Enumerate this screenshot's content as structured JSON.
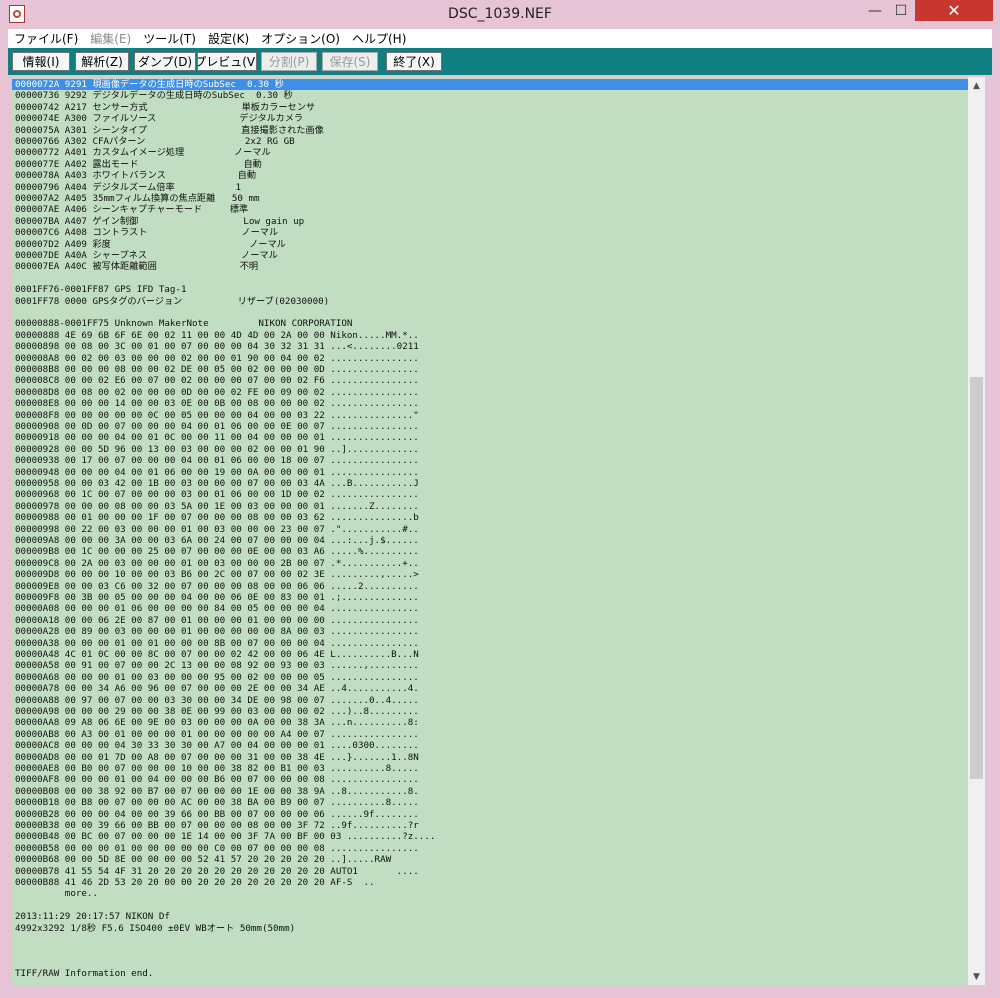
{
  "window": {
    "title": "DSC_1039.NEF",
    "minimize": "—",
    "maximize": "☐",
    "close": "✕"
  },
  "menu": [
    "ファイル(F)",
    "編集(E)",
    "ツール(T)",
    "設定(K)",
    "オプション(O)",
    "ヘルプ(H)"
  ],
  "menu_disabled": [
    false,
    true,
    false,
    false,
    false,
    false
  ],
  "toolbar": {
    "buttons": [
      "情報(I)",
      "解析(Z)",
      "ダンプ(D)",
      "プレビュ(V)",
      "分割(P)",
      "保存(S)",
      "終了(X)"
    ],
    "disabled": [
      false,
      false,
      false,
      false,
      true,
      true,
      false
    ]
  },
  "scrollbar": {
    "position": 0.6,
    "visible_fraction": 0.46
  },
  "lines": [
    "0000072A 9291 現画像データの生成日時のSubSec  0.30 秒",
    "00000736 9292 デジタルデータの生成日時のSubSec  0.30 秒",
    "00000742 A217 センサー方式                 単板カラーセンサ",
    "0000074E A300 ファイルソース               デジタルカメラ",
    "0000075A A301 シーンタイプ                 直接撮影された画像",
    "00000766 A302 CFAパターン                  2x2 RG GB",
    "00000772 A401 カスタムイメージ処理         ノーマル",
    "0000077E A402 露出モード                   自動",
    "0000078A A403 ホワイトバランス             自動",
    "00000796 A404 デジタルズーム倍率           1",
    "000007A2 A405 35mmフィルム換算の焦点距離   50 mm",
    "000007AE A406 シーンキャプチャーモード     標準",
    "000007BA A407 ゲイン制御                   Low gain up",
    "000007C6 A408 コントラスト                 ノーマル",
    "000007D2 A409 彩度                         ノーマル",
    "000007DE A40A シャープネス                 ノーマル",
    "000007EA A40C 被写体距離範囲               不明",
    "",
    "0001FF76-0001FF87 GPS IFD Tag-1",
    "0001FF78 0000 GPSタグのバージョン          リザーブ(02030000)",
    "",
    "00000888-0001FF75 Unknown MakerNote         NIKON CORPORATION",
    "00000888 4E 69 6B 6F 6E 00 02 11 00 00 4D 4D 00 2A 00 00 Nikon.....MM.*..",
    "00000898 00 08 00 3C 00 01 00 07 00 00 00 04 30 32 31 31 ...<........0211",
    "000008A8 00 02 00 03 00 00 00 02 00 00 01 90 00 04 00 02 ................",
    "000008B8 00 00 00 08 00 00 02 DE 00 05 00 02 00 00 00 0D ................",
    "000008C8 00 00 02 E6 00 07 00 02 00 00 00 07 00 00 02 F6 ................",
    "000008D8 00 08 00 02 00 00 00 0D 00 00 02 FE 00 09 00 02 ................",
    "000008E8 00 00 00 14 00 00 03 0E 00 0B 00 08 00 00 00 02 ................",
    "000008F8 00 00 00 00 00 0C 00 05 00 00 00 04 00 00 03 22 ...............\"",
    "00000908 00 0D 00 07 00 00 00 04 00 01 06 00 00 0E 00 07 ................",
    "00000918 00 00 00 04 00 01 0C 00 00 11 00 04 00 00 00 01 ................",
    "00000928 00 00 5D 96 00 13 00 03 00 00 00 02 00 00 01 90 ..].............",
    "00000938 00 17 00 07 00 00 00 04 00 01 06 00 00 18 00 07 ................",
    "00000948 00 00 00 04 00 01 06 00 00 19 00 0A 00 00 00 01 ................",
    "00000958 00 00 03 42 00 1B 00 03 00 00 00 07 00 00 03 4A ...B...........J",
    "00000968 00 1C 00 07 00 00 00 03 00 01 06 00 00 1D 00 02 ................",
    "00000978 00 00 00 08 00 00 03 5A 00 1E 00 03 00 00 00 01 .......Z........",
    "00000988 00 01 00 00 00 1F 00 07 00 00 00 08 00 00 03 62 ...............b",
    "00000998 00 22 00 03 00 00 00 01 00 03 00 00 00 23 00 07 .\"...........#..",
    "000009A8 00 00 00 3A 00 00 03 6A 00 24 00 07 00 00 00 04 ...:...j.$......",
    "000009B8 00 1C 00 00 00 25 00 07 00 00 00 0E 00 00 03 A6 .....%..........",
    "000009C8 00 2A 00 03 00 00 00 01 00 03 00 00 00 2B 00 07 .*...........+..",
    "000009D8 00 00 00 10 00 00 03 B6 00 2C 00 07 00 00 02 3E .........,.....>",
    "000009E8 00 00 03 C6 00 32 00 07 00 00 00 08 00 00 06 06 .....2..........",
    "000009F8 00 3B 00 05 00 00 00 04 00 00 06 0E 00 83 00 01 .;..............",
    "00000A08 00 00 00 01 06 00 00 00 00 84 00 05 00 00 00 04 ................",
    "00000A18 00 00 06 2E 00 87 00 01 00 00 00 01 00 00 00 00 ................",
    "00000A28 00 89 00 03 00 00 00 01 00 00 00 00 00 8A 00 03 ................",
    "00000A38 00 00 00 01 00 01 00 00 00 8B 00 07 00 00 00 04 ................",
    "00000A48 4C 01 0C 00 00 8C 00 07 00 00 02 42 00 00 06 4E L..........B...N",
    "00000A58 00 91 00 07 00 00 2C 13 00 00 08 92 00 93 00 03 ......,.........",
    "00000A68 00 00 00 01 00 03 00 00 00 95 00 02 00 00 00 05 ................",
    "00000A78 00 00 34 A6 00 96 00 07 00 00 00 2E 00 00 34 AE ..4...........4.",
    "00000A88 00 97 00 07 00 00 03 30 00 00 34 DE 00 98 00 07 .......0..4.....",
    "00000A98 00 00 00 29 00 00 38 0E 00 99 00 03 00 00 00 02 ...)..8.........",
    "00000AA8 09 A8 06 6E 00 9E 00 03 00 00 00 0A 00 00 38 3A ...n..........8:",
    "00000AB8 00 A3 00 01 00 00 00 01 00 00 00 00 00 A4 00 07 ................",
    "00000AC8 00 00 00 04 30 33 30 30 00 A7 00 04 00 00 00 01 ....0300........",
    "00000AD8 00 00 01 7D 00 A8 00 07 00 00 00 31 00 00 38 4E ...}.......1..8N",
    "00000AE8 00 B0 00 07 00 00 00 10 00 00 38 82 00 B1 00 03 ..........8.....",
    "00000AF8 00 00 00 01 00 04 00 00 00 B6 00 07 00 00 00 08 ................",
    "00000B08 00 00 38 92 00 B7 00 07 00 00 00 1E 00 00 38 9A ..8...........8.",
    "00000B18 00 B8 00 07 00 00 00 AC 00 00 38 BA 00 B9 00 07 ..........8.....",
    "00000B28 00 00 00 04 00 00 39 66 00 BB 00 07 00 00 00 06 ......9f........",
    "00000B38 00 00 39 66 00 BB 00 07 00 00 00 08 00 00 3F 72 ..9f..........?r",
    "00000B48 00 BC 00 07 00 00 00 1E 14 00 00 3F 7A 00 BF 00 03 ..........?z....",
    "00000B58 00 00 00 01 00 00 00 00 00 C0 00 07 00 00 00 08 ................",
    "00000B68 00 00 5D 8E 00 00 00 00 52 41 57 20 20 20 20 20 ..].....RAW     ",
    "00000B78 41 55 54 4F 31 20 20 20 20 20 20 20 20 20 20 20 AUTO1       ....",
    "00000B88 41 46 2D 53 20 20 00 00 20 20 20 20 20 20 20 20 AF-S  ..",
    "         more..",
    "",
    "2013:11:29 20:17:57 NIKON Df",
    "4992x3292 1/8秒 F5.6 ISO400 ±0EV WBオート 50mm(50mm)",
    "",
    "",
    "",
    "TIFF/RAW Information end."
  ]
}
